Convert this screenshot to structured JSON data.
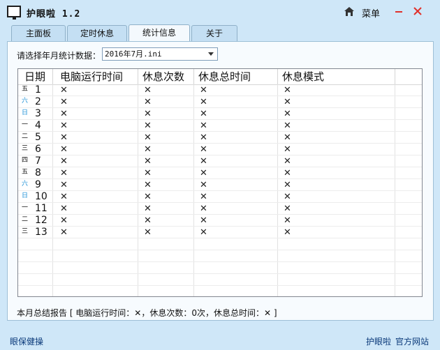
{
  "app": {
    "title": "护眼啦 1.2",
    "menu_label": "菜单"
  },
  "tabs": [
    {
      "label": "主面板"
    },
    {
      "label": "定时休息"
    },
    {
      "label": "统计信息"
    },
    {
      "label": "关于"
    }
  ],
  "stats": {
    "month_label": "请选择年月统计数据：",
    "month_value": "2016年7月.ini",
    "columns": [
      "日期",
      "电脑运行时间",
      "休息次数",
      "休息总时间",
      "休息模式"
    ],
    "rows": [
      {
        "weekday": "五",
        "day": "1",
        "run": "✕",
        "count": "✕",
        "total": "✕",
        "mode": "✕",
        "weekend": false
      },
      {
        "weekday": "六",
        "day": "2",
        "run": "✕",
        "count": "✕",
        "total": "✕",
        "mode": "✕",
        "weekend": true
      },
      {
        "weekday": "日",
        "day": "3",
        "run": "✕",
        "count": "✕",
        "total": "✕",
        "mode": "✕",
        "weekend": true
      },
      {
        "weekday": "一",
        "day": "4",
        "run": "✕",
        "count": "✕",
        "total": "✕",
        "mode": "✕",
        "weekend": false
      },
      {
        "weekday": "二",
        "day": "5",
        "run": "✕",
        "count": "✕",
        "total": "✕",
        "mode": "✕",
        "weekend": false
      },
      {
        "weekday": "三",
        "day": "6",
        "run": "✕",
        "count": "✕",
        "total": "✕",
        "mode": "✕",
        "weekend": false
      },
      {
        "weekday": "四",
        "day": "7",
        "run": "✕",
        "count": "✕",
        "total": "✕",
        "mode": "✕",
        "weekend": false
      },
      {
        "weekday": "五",
        "day": "8",
        "run": "✕",
        "count": "✕",
        "total": "✕",
        "mode": "✕",
        "weekend": false
      },
      {
        "weekday": "六",
        "day": "9",
        "run": "✕",
        "count": "✕",
        "total": "✕",
        "mode": "✕",
        "weekend": true
      },
      {
        "weekday": "日",
        "day": "10",
        "run": "✕",
        "count": "✕",
        "total": "✕",
        "mode": "✕",
        "weekend": true
      },
      {
        "weekday": "一",
        "day": "11",
        "run": "✕",
        "count": "✕",
        "total": "✕",
        "mode": "✕",
        "weekend": false
      },
      {
        "weekday": "二",
        "day": "12",
        "run": "✕",
        "count": "✕",
        "total": "✕",
        "mode": "✕",
        "weekend": false
      },
      {
        "weekday": "三",
        "day": "13",
        "run": "✕",
        "count": "✕",
        "total": "✕",
        "mode": "✕",
        "weekend": false
      }
    ],
    "summary": "本月总结报告 [ 电脑运行时间：✕，休息次数：0次，休息总时间：✕ ]"
  },
  "footer": {
    "left": "眼保健操",
    "right_1": "护眼啦",
    "right_2": "官方网站"
  },
  "colors": {
    "background": "#cfe7f8",
    "weekend": "#1a8fd6",
    "link": "#0b3a7a"
  }
}
